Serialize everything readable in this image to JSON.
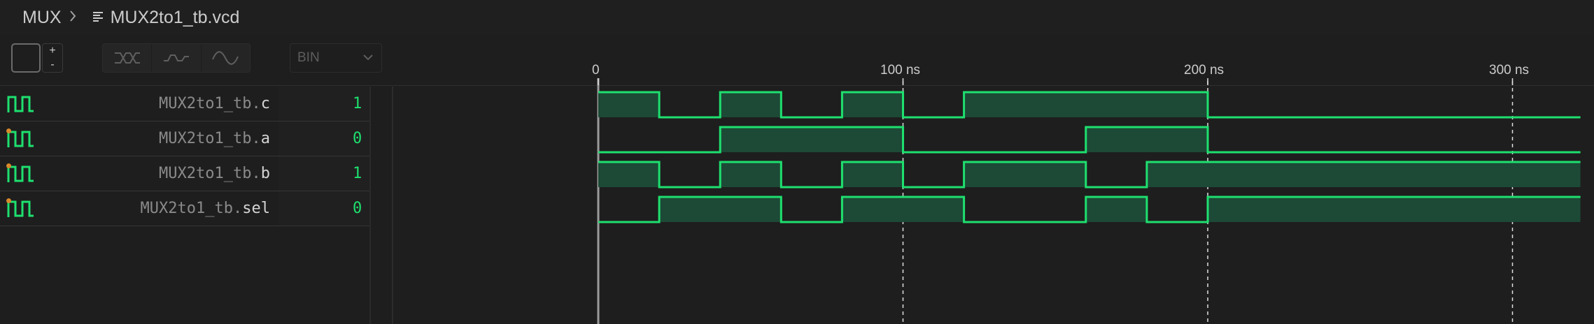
{
  "breadcrumb": {
    "folder": "MUX",
    "file": "MUX2to1_tb.vcd"
  },
  "toolbar": {
    "stepper_plus": "+",
    "stepper_minus": "-",
    "radix_value": "BIN",
    "buttons": [
      {
        "icon": "bus-icon"
      },
      {
        "icon": "step-wave-icon"
      },
      {
        "icon": "sine-wave-icon"
      }
    ]
  },
  "timeline": {
    "ticks": [
      "0",
      "100 ns",
      "200 ns",
      "300 ns"
    ]
  },
  "signals": [
    {
      "scope": "MUX2to1_tb.",
      "leaf": "c",
      "value": "1",
      "marker": false
    },
    {
      "scope": "MUX2to1_tb.",
      "leaf": "a",
      "value": "0",
      "marker": true
    },
    {
      "scope": "MUX2to1_tb.",
      "leaf": "b",
      "value": "1",
      "marker": true
    },
    {
      "scope": "MUX2to1_tb.",
      "leaf": "sel",
      "value": "0",
      "marker": true
    }
  ],
  "colors": {
    "wave_line": "#1ee06f",
    "wave_fill": "#1c4a36",
    "value_text": "#1ee06f",
    "marker": "#d9892b"
  },
  "chart_data": {
    "type": "timing",
    "x_unit": "ns",
    "xlim": [
      0,
      320
    ],
    "ticks": [
      0,
      100,
      200,
      300
    ],
    "series": [
      {
        "name": "MUX2to1_tb.c",
        "transitions": [
          [
            0,
            1
          ],
          [
            20,
            0
          ],
          [
            40,
            1
          ],
          [
            60,
            0
          ],
          [
            80,
            1
          ],
          [
            100,
            0
          ],
          [
            120,
            1
          ],
          [
            200,
            0
          ]
        ]
      },
      {
        "name": "MUX2to1_tb.a",
        "transitions": [
          [
            0,
            0
          ],
          [
            40,
            1
          ],
          [
            100,
            0
          ],
          [
            160,
            1
          ],
          [
            200,
            0
          ]
        ]
      },
      {
        "name": "MUX2to1_tb.b",
        "transitions": [
          [
            0,
            1
          ],
          [
            20,
            0
          ],
          [
            40,
            1
          ],
          [
            60,
            0
          ],
          [
            80,
            1
          ],
          [
            100,
            0
          ],
          [
            120,
            1
          ],
          [
            160,
            0
          ],
          [
            180,
            1
          ]
        ]
      },
      {
        "name": "MUX2to1_tb.sel",
        "transitions": [
          [
            0,
            0
          ],
          [
            20,
            1
          ],
          [
            60,
            0
          ],
          [
            80,
            1
          ],
          [
            120,
            0
          ],
          [
            160,
            1
          ],
          [
            180,
            0
          ],
          [
            200,
            1
          ]
        ]
      }
    ]
  }
}
